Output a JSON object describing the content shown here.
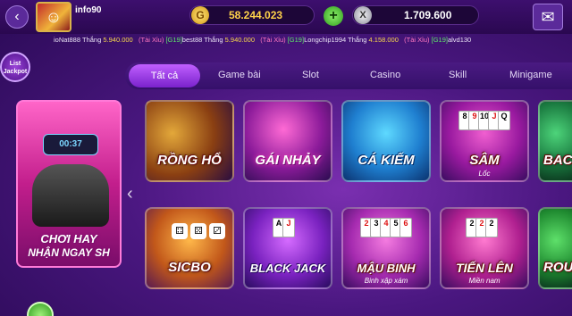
{
  "header": {
    "back_icon": "‹",
    "avatar_icon": "☺",
    "username": "info90",
    "gold_icon": "G",
    "gold_balance": "58.244.023",
    "add_icon": "+",
    "silver_icon": "X",
    "silver_balance": "1.709.600",
    "mail_icon": "✉"
  },
  "ticker": {
    "items": [
      {
        "user": "ioNat888",
        "text": "Thắng",
        "amount": "5.940.000"
      },
      {
        "room": "(Tài Xỉu)",
        "tag": "[G19]",
        "user": "best88",
        "text": "Thắng",
        "amount": "5.940.000"
      },
      {
        "room": "(Tài Xỉu)",
        "tag": "[G19]",
        "user": "Longchip1994",
        "text": "Thắng",
        "amount": "4.158.000"
      },
      {
        "room": "(Tài Xỉu)",
        "tag": "[G19]",
        "user": "alvd130"
      }
    ]
  },
  "jackpot": {
    "line1": "List",
    "line2": "Jackpot"
  },
  "tabs": [
    "Tất cả",
    "Game bài",
    "Slot",
    "Casino",
    "Skill",
    "Minigame"
  ],
  "promo": {
    "timer": "00:37",
    "line1": "CHƠI HAY",
    "line2": "NHẬN NGAY SH"
  },
  "nav": {
    "left_arrow": "‹"
  },
  "games_row1": [
    {
      "label": "RỒNG HỔ",
      "sub": ""
    },
    {
      "label": "GÁI NHẢY",
      "sub": ""
    },
    {
      "label": "CÁ KIẾM",
      "sub": ""
    },
    {
      "label": "SÂM",
      "sub": "Lốc"
    },
    {
      "label": "BAC",
      "sub": ""
    }
  ],
  "games_row2": [
    {
      "label": "SICBO",
      "sub": ""
    },
    {
      "label": "BLACK JACK",
      "sub": ""
    },
    {
      "label": "MẬU BINH",
      "sub": "Binh xập xám"
    },
    {
      "label": "TIẾN LÊN",
      "sub": "Miền nam"
    },
    {
      "label": "ROU",
      "sub": ""
    }
  ],
  "card_glyphs": {
    "sam": [
      "8",
      "9",
      "10",
      "J",
      "Q"
    ],
    "black": [
      "A",
      "J"
    ],
    "maubinh": [
      "2",
      "3",
      "4",
      "5",
      "6"
    ],
    "tienlen": [
      "2",
      "2",
      "2"
    ]
  },
  "dice": [
    "⚃",
    "⚄",
    "⚂"
  ]
}
